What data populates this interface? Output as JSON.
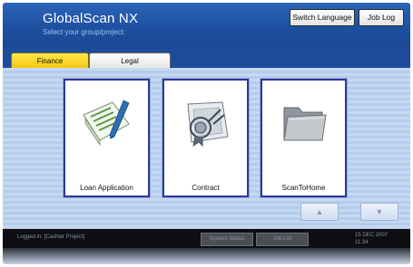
{
  "header": {
    "title": "GlobalScan NX",
    "subtitle": "Select your group/project.",
    "switch_language": "Switch Language",
    "job_log": "Job Log"
  },
  "tabs": [
    {
      "label": "Finance",
      "active": true
    },
    {
      "label": "Legal",
      "active": false
    }
  ],
  "tiles": [
    {
      "label": "Loan Application",
      "icon": "loan-form-pen-icon"
    },
    {
      "label": "Contract",
      "icon": "contract-seal-icon"
    },
    {
      "label": "ScanToHome",
      "icon": "folder-icon"
    }
  ],
  "nav": {
    "up": "▲",
    "down": "▼"
  },
  "status": {
    "logged_in": "Logged in: [Cashier Project]",
    "btn1": "System Status",
    "btn2": "Job List",
    "date": "15 DEC 2007",
    "time": "11:34"
  },
  "colors": {
    "header_blue": "#1d4fa0",
    "tab_active": "#f5c40f",
    "content_bg": "#c4d8f2",
    "tile_border": "#2a3a9a",
    "statusbar": "#0d0d12"
  }
}
